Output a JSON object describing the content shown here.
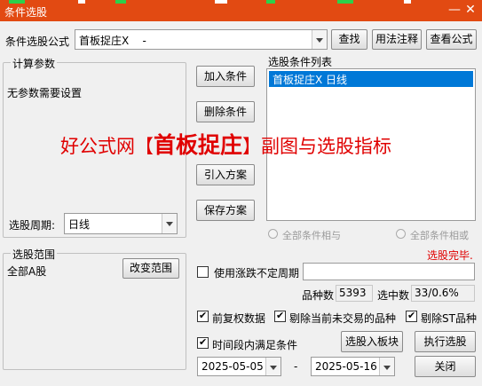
{
  "window": {
    "title": "条件选股",
    "accent": "#e24a12",
    "minimize_label": "—",
    "close_label": "✕"
  },
  "formula": {
    "label": "条件选股公式",
    "value": "首板捉庄X    -",
    "find_label": "查找",
    "usage_label": "用法注释",
    "view_label": "查看公式"
  },
  "params": {
    "legend": "计算参数",
    "message": "无参数需要设置"
  },
  "actions": {
    "add_label": "加入条件",
    "delete_label": "删除条件",
    "import_label": "引入方案",
    "save_label": "保存方案"
  },
  "conditions": {
    "legend": "选股条件列表",
    "items": [
      "首板捉庄X  日线"
    ]
  },
  "period": {
    "label": "选股周期:",
    "value": "日线"
  },
  "logic": {
    "all_and_label": "全部条件相与",
    "all_or_label": "全部条件相或"
  },
  "status_text": "选股完毕.",
  "range": {
    "legend": "选股范围",
    "value": "全部A股",
    "change_label": "改变范围"
  },
  "volatility": {
    "label": "使用涨跌不定周期",
    "value": ""
  },
  "counts": {
    "total_label": "品种数",
    "total_value": "5393",
    "selected_label": "选中数",
    "selected_value": "33/0.6%"
  },
  "options": {
    "adjust_label": "前复权数据",
    "exclude_untraded_label": "剔除当前未交易的品种",
    "exclude_st_label": "剔除ST品种",
    "period_condition_label": "时间段内满足条件"
  },
  "run": {
    "to_block_label": "选股入板块",
    "execute_label": "执行选股",
    "close_label": "关闭"
  },
  "dates": {
    "start": "2025-05-05",
    "separator": "-",
    "end": "2025-05-16"
  },
  "watermark": {
    "prefix": "好公式网【",
    "highlight": "首板捉庄",
    "suffix": "】副图与选股指标"
  }
}
